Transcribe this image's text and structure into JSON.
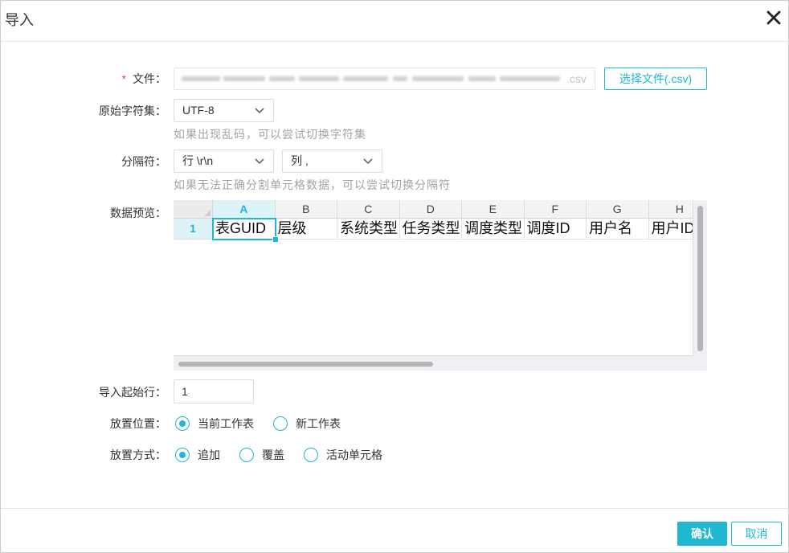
{
  "dialog": {
    "title": "导入"
  },
  "form": {
    "file": {
      "required_mark": "*",
      "label": "文件：",
      "value_suffix": ".csv",
      "button_label": "选择文件(.csv)"
    },
    "charset": {
      "label": "原始字符集：",
      "selected": "UTF-8",
      "hint": "如果出现乱码，可以尝试切换字符集"
    },
    "separator": {
      "label": "分隔符：",
      "row_selected": "行 \\r\\n",
      "column_selected": "列 ,",
      "hint": "如果无法正确分割单元格数据，可以尝试切换分隔符"
    },
    "preview": {
      "label": "数据预览：",
      "columns": [
        "A",
        "B",
        "C",
        "D",
        "E",
        "F",
        "G",
        "H"
      ],
      "rows": [
        {
          "index": "1",
          "cells": [
            "表GUID",
            "层级",
            "系统类型",
            "任务类型",
            "调度类型",
            "调度ID",
            "用户名",
            "用户ID"
          ]
        }
      ],
      "selected_column": 0,
      "selected_row": 0
    },
    "start_row": {
      "label": "导入起始行：",
      "value": "1"
    },
    "placement": {
      "label": "放置位置：",
      "options": [
        {
          "label": "当前工作表",
          "checked": true
        },
        {
          "label": "新工作表",
          "checked": false
        }
      ]
    },
    "method": {
      "label": "放置方式：",
      "options": [
        {
          "label": "追加",
          "checked": true
        },
        {
          "label": "覆盖",
          "checked": false
        },
        {
          "label": "活动单元格",
          "checked": false
        }
      ]
    }
  },
  "footer": {
    "confirm_label": "确认",
    "cancel_label": "取消"
  },
  "icons": {
    "close": "close-icon",
    "dropdown": "chevron-down-icon"
  },
  "colors": {
    "accent": "#1fb7d1",
    "required": "#e8473d",
    "hint": "#a3a3a3"
  }
}
